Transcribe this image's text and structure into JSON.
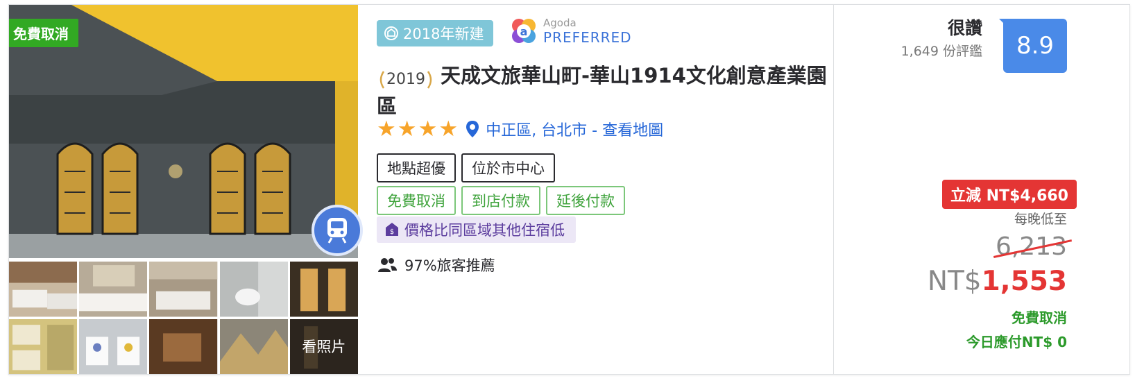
{
  "gallery": {
    "badge_free_cancel": "免費取消",
    "see_photos_label": "看照片",
    "transit_icon": "train-icon",
    "main_photo_icon": "hotel-facade-photo"
  },
  "info": {
    "new_built_label": "2018年新建",
    "agoda_small": "Agoda",
    "agoda_big": "PREFERRED",
    "award_year": "2019",
    "hotel_name": "天成文旅華山町-華山1914文化創意產業園區",
    "star_count": 4,
    "location_text": "中正區, 台北市 - 查看地圖",
    "feature_tags": [
      "地點超優",
      "位於市中心"
    ],
    "benefit_tags": [
      "免費取消",
      "到店付款",
      "延後付款"
    ],
    "lower_price_label": "價格比同區域其他住宿低",
    "recommend_text": "97%旅客推薦"
  },
  "price": {
    "review_word": "很讚",
    "review_count": "1,649 份評鑑",
    "score": "8.9",
    "discount_label": "立減 NT$4,660",
    "per_night_label": "每晚低至",
    "original_price": "6,213",
    "currency_symbol": "NT$",
    "current_price": "1,553",
    "free_cancel_label": "免費取消",
    "pay_today_label": "今日應付NT$ 0"
  },
  "colors": {
    "free_cancel_green": "#32a923",
    "link_blue": "#2667d8",
    "star_orange": "#f7a42a",
    "score_blue": "#4a8ae8",
    "discount_red": "#e43534",
    "new_built_teal": "#7fc6d8"
  }
}
